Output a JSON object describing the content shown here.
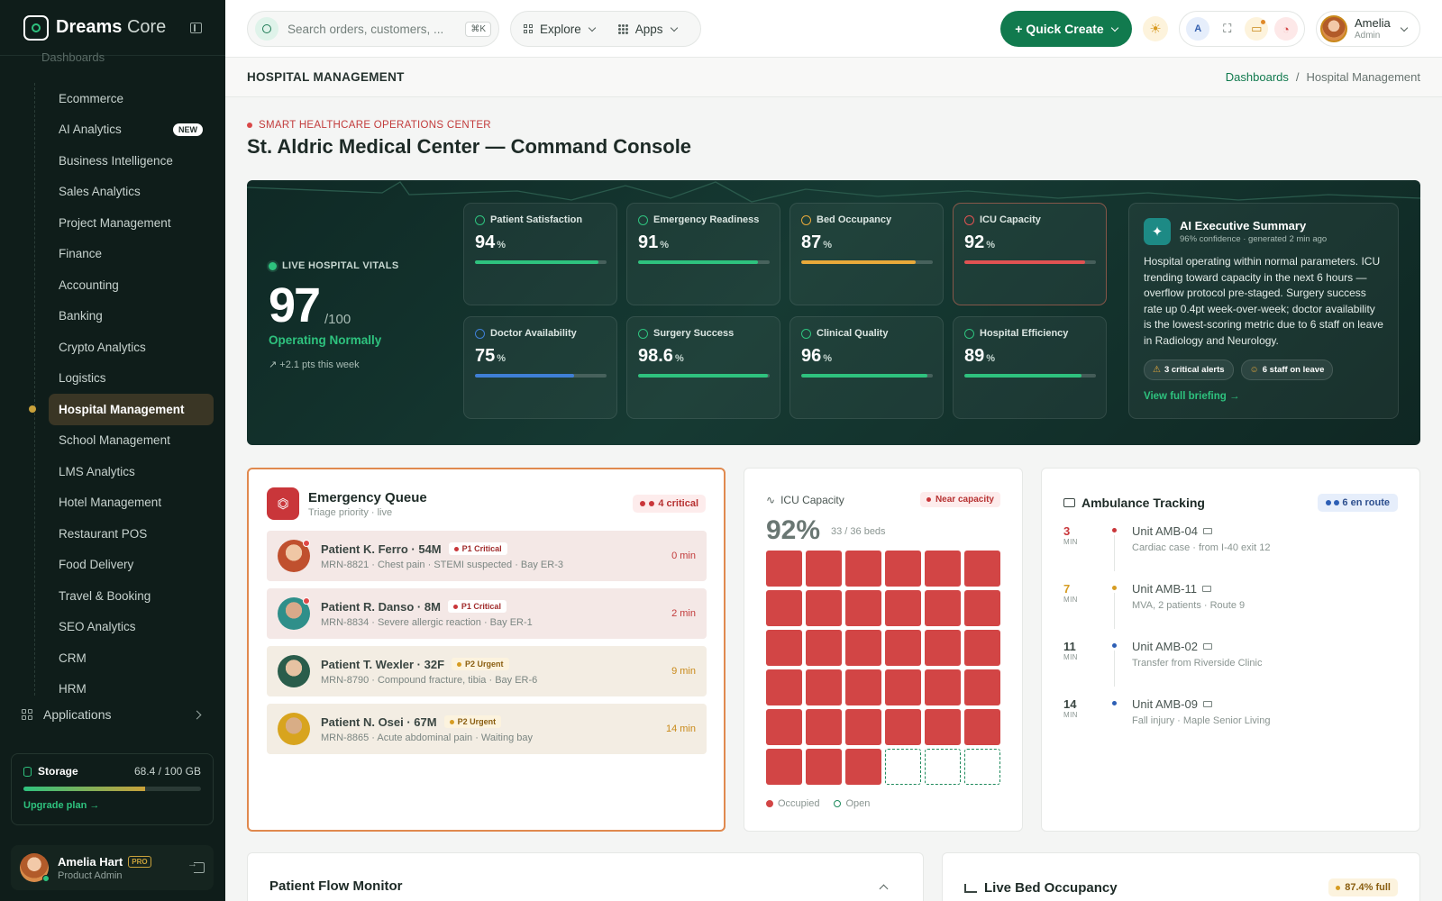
{
  "brand": {
    "name_bold": "Dreams",
    "name_light": "Core"
  },
  "sidebar": {
    "group_label": "Dashboards",
    "items": [
      {
        "label": "Ecommerce"
      },
      {
        "label": "AI Analytics",
        "badge": "NEW"
      },
      {
        "label": "Business Intelligence"
      },
      {
        "label": "Sales Analytics"
      },
      {
        "label": "Project Management"
      },
      {
        "label": "Finance"
      },
      {
        "label": "Accounting"
      },
      {
        "label": "Banking"
      },
      {
        "label": "Crypto Analytics"
      },
      {
        "label": "Logistics"
      },
      {
        "label": "Hospital Management",
        "active": true
      },
      {
        "label": "School Management"
      },
      {
        "label": "LMS Analytics"
      },
      {
        "label": "Hotel Management"
      },
      {
        "label": "Restaurant POS"
      },
      {
        "label": "Food Delivery"
      },
      {
        "label": "Travel & Booking"
      },
      {
        "label": "SEO Analytics"
      },
      {
        "label": "CRM"
      },
      {
        "label": "HRM"
      }
    ],
    "applications_label": "Applications",
    "storage": {
      "title": "Storage",
      "value": "68.4 / 100 GB",
      "used_fraction": 0.684,
      "upgrade_label": "Upgrade plan →"
    },
    "user": {
      "name": "Amelia Hart",
      "badge": "PRO",
      "role": "Product Admin"
    }
  },
  "topbar": {
    "search_placeholder": "Search orders, customers, ...",
    "search_shortcut": "⌘K",
    "explore_label": "Explore",
    "apps_label": "Apps",
    "quick_create_label": "+  Quick Create",
    "profile": {
      "name": "Amelia",
      "role": "Admin"
    }
  },
  "page": {
    "header_title": "HOSPITAL MANAGEMENT",
    "breadcrumb_root": "Dashboards",
    "breadcrumb_current": "Hospital Management",
    "eyebrow": "SMART HEALTHCARE OPERATIONS CENTER",
    "title": "St. Aldric Medical Center — Command Console"
  },
  "hero": {
    "vitals_label": "LIVE HOSPITAL VITALS",
    "score": "97",
    "score_max": "/100",
    "status": "Operating Normally",
    "trend": "↗ +2.1 pts this week",
    "kpis": [
      {
        "label": "Patient Satisfaction",
        "value": "94",
        "unit": "%",
        "fraction": 0.94,
        "color": "#2ec27e"
      },
      {
        "label": "Emergency Readiness",
        "value": "91",
        "unit": "%",
        "fraction": 0.91,
        "color": "#2ec27e"
      },
      {
        "label": "Bed Occupancy",
        "value": "87",
        "unit": "%",
        "fraction": 0.87,
        "color": "#e8a93a"
      },
      {
        "label": "ICU Capacity",
        "value": "92",
        "unit": "%",
        "fraction": 0.92,
        "color": "#e05252",
        "warn": true
      },
      {
        "label": "Doctor Availability",
        "value": "75",
        "unit": "%",
        "fraction": 0.75,
        "color": "#3f7fd6"
      },
      {
        "label": "Surgery Success",
        "value": "98.6",
        "unit": "%",
        "fraction": 0.986,
        "color": "#2ec27e"
      },
      {
        "label": "Clinical Quality",
        "value": "96",
        "unit": "%",
        "fraction": 0.96,
        "color": "#2ec27e"
      },
      {
        "label": "Hospital Efficiency",
        "value": "89",
        "unit": "%",
        "fraction": 0.89,
        "color": "#2ec27e"
      }
    ],
    "ai": {
      "title": "AI Executive Summary",
      "sub": "96% confidence · generated 2 min ago",
      "text": "Hospital operating within normal parameters. ICU trending toward capacity in the next 6 hours — overflow protocol pre-staged. Surgery success rate up 0.4pt week-over-week; doctor availability is the lowest-scoring metric due to 6 staff on leave in Radiology and Neurology.",
      "chip_alerts": "3 critical alerts",
      "chip_leave": "6 staff on leave",
      "link": "View full briefing →"
    }
  },
  "emergency": {
    "title": "Emergency Queue",
    "sub": "Triage priority · live",
    "badge": "4 critical",
    "patients": [
      {
        "name": "Patient K. Ferro · 54M",
        "priority": "P1 Critical",
        "level": "critical",
        "desc": "MRN-8821 · Chest pain · STEMI suspected · Bay ER-3",
        "time": "0 min"
      },
      {
        "name": "Patient R. Danso · 8M",
        "priority": "P1 Critical",
        "level": "critical",
        "desc": "MRN-8834 · Severe allergic reaction · Bay ER-1",
        "time": "2 min"
      },
      {
        "name": "Patient T. Wexler · 32F",
        "priority": "P2 Urgent",
        "level": "urgent",
        "desc": "MRN-8790 · Compound fracture, tibia · Bay ER-6",
        "time": "9 min"
      },
      {
        "name": "Patient N. Osei · 67M",
        "priority": "P2 Urgent",
        "level": "urgent",
        "desc": "MRN-8865 · Acute abdominal pain · Waiting bay",
        "time": "14 min"
      }
    ]
  },
  "icu": {
    "label": "ICU Capacity",
    "badge": "Near capacity",
    "percent": "92%",
    "beds_text": "33 / 36 beds",
    "occupied": 33,
    "total": 36,
    "legend_occupied": "Occupied",
    "legend_open": "Open",
    "colors": {
      "occupied": "#d24545",
      "open": "#1e8a5c"
    }
  },
  "ambulance": {
    "title": "Ambulance Tracking",
    "badge": "6 en route",
    "eta_unit": "MIN",
    "units": [
      {
        "eta": "3",
        "unit": "Unit AMB-04",
        "desc": "Cardiac case · from I-40 exit 12",
        "color": "#c9363a"
      },
      {
        "eta": "7",
        "unit": "Unit AMB-11",
        "desc": "MVA, 2 patients · Route 9",
        "color": "#d69c22"
      },
      {
        "eta": "11",
        "unit": "Unit AMB-02",
        "desc": "Transfer from Riverside Clinic",
        "color": "#2d5fb5"
      },
      {
        "eta": "14",
        "unit": "Unit AMB-09",
        "desc": "Fall injury · Maple Senior Living",
        "color": "#2d5fb5"
      }
    ]
  },
  "flow": {
    "title": "Patient Flow Monitor"
  },
  "bed_occupancy": {
    "title": "Live Bed Occupancy",
    "badge": "87.4% full"
  }
}
